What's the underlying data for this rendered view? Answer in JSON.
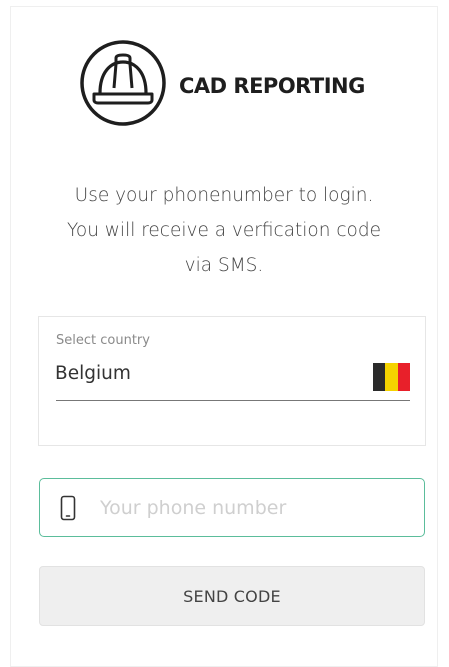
{
  "brand": {
    "name": "CAD REPORTING",
    "logo_icon": "helmet-icon"
  },
  "intro": {
    "line1": "Use your phonenumber to login.",
    "line2": "You will receive a verfication code",
    "line3": "via SMS."
  },
  "country": {
    "label": "Select country",
    "value": "Belgium",
    "flag_icon": "belgium-flag-icon",
    "flag_colors": [
      "#2b2b2b",
      "#f5d300",
      "#e8202a"
    ]
  },
  "phone": {
    "icon": "mobile-phone-icon",
    "placeholder": "Your phone number",
    "value": ""
  },
  "actions": {
    "send_label": "SEND CODE"
  },
  "colors": {
    "accent": "#5bbd9b",
    "button_bg": "#efefef"
  }
}
